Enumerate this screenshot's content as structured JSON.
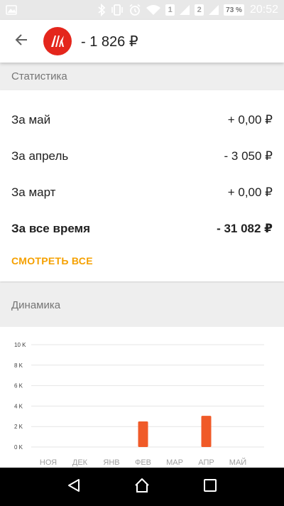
{
  "status_bar": {
    "time": "20:52",
    "sim1": "1",
    "sim2": "2",
    "battery": "73 %",
    "icons": [
      "image-icon",
      "bluetooth-icon",
      "vibrate-icon",
      "alarm-icon",
      "wifi-icon",
      "signal-icon"
    ]
  },
  "header": {
    "balance": "- 1 826 ₽",
    "logo_text": "ЛУКОЙЛ",
    "brand_color": "#e4261c"
  },
  "stats": {
    "section_title": "Статистика",
    "rows": [
      {
        "label": "За май",
        "value": "+ 0,00 ₽"
      },
      {
        "label": "За апрель",
        "value": "- 3 050 ₽"
      },
      {
        "label": "За март",
        "value": "+ 0,00 ₽"
      },
      {
        "label": "За все время",
        "value": "- 31 082 ₽"
      }
    ],
    "view_all": "СМОТРЕТЬ ВСЕ",
    "accent_color": "#f5a000"
  },
  "dynamics": {
    "section_title": "Динамика"
  },
  "chart_data": {
    "type": "bar",
    "categories": [
      "НОЯ",
      "ДЕК",
      "ЯНВ",
      "ФЕВ",
      "МАР",
      "АПР",
      "МАЙ"
    ],
    "values": [
      0,
      0,
      0,
      2500,
      0,
      3050,
      0
    ],
    "y_tick_labels": [
      "0 K",
      "2 K",
      "4 K",
      "6 K",
      "8 K",
      "10 K"
    ],
    "ylim": [
      0,
      10000
    ],
    "grid": true,
    "bar_color": "#f05a28",
    "title": "",
    "xlabel": "",
    "ylabel": ""
  }
}
